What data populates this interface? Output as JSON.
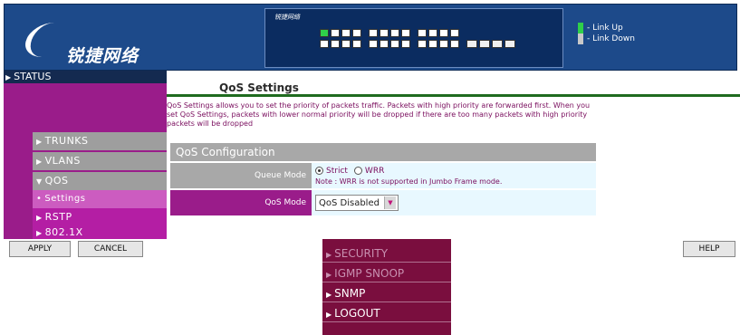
{
  "header": {
    "brand_name": "锐捷网络",
    "switch_brand": "锐捷网络",
    "legend": [
      {
        "label": "- Link Up",
        "color": "#2fd04a"
      },
      {
        "label": "- Link Down",
        "color": "#c8c8c8"
      }
    ]
  },
  "sidebar": {
    "status_label": "STATUS",
    "items": [
      {
        "label": "TRUNKS"
      },
      {
        "label": "VLANS"
      },
      {
        "label": "QOS"
      },
      {
        "label": "Settings"
      },
      {
        "label": "RSTP"
      },
      {
        "label": "802.1X"
      }
    ]
  },
  "content": {
    "title": "QoS Settings",
    "description": "QoS Settings allows you to set the priority of packets traffic. Packets with high priority are forwarded first. When you set QoS Settings, packets with lower normal priority will be dropped if there are too many packets with high priority packets will be dropped",
    "config": {
      "heading": "QoS Configuration",
      "queue_mode_label": "Queue Mode",
      "strict_label": "Strict",
      "wrr_label": "WRR",
      "note": "Note : WRR is not supported in Jumbo Frame mode.",
      "qos_mode_label": "QoS Mode",
      "qos_mode_value": "QoS Disabled"
    }
  },
  "footer": {
    "apply_label": "APPLY",
    "cancel_label": "CANCEL",
    "help_label": "HELP"
  },
  "dropdown_menu": {
    "items": [
      {
        "label": "SECURITY"
      },
      {
        "label": "IGMP SNOOP"
      },
      {
        "label": "SNMP"
      },
      {
        "label": "LOGOUT"
      }
    ]
  },
  "colors": {
    "header_bg": "#1d4a8a",
    "sidebar_bg": "#9a1c8a",
    "menu_bg": "#7a0e3e",
    "config_bg": "#e8f8ff"
  }
}
